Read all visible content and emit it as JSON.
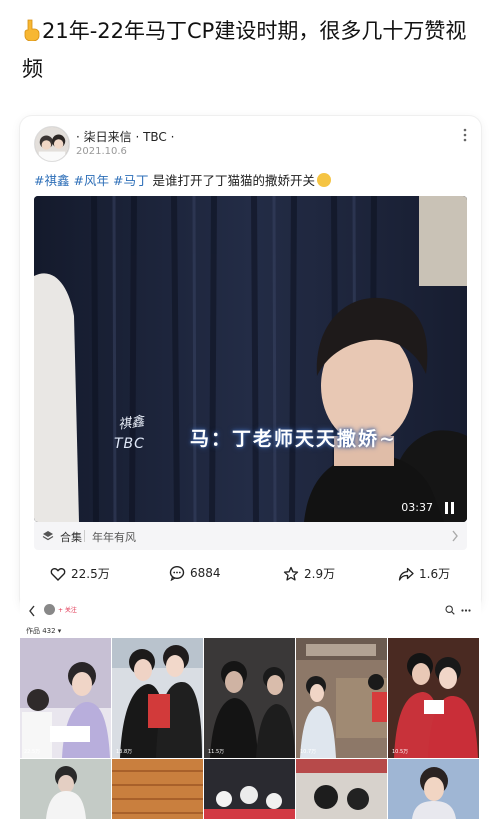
{
  "headline": "21年-22年马丁CP建设时期，很多几十万赞视频",
  "post": {
    "author": "· 柒日来信 · TBC ·",
    "date": "2021.10.6",
    "tags": [
      "#祺鑫",
      "#风年",
      "#马丁"
    ],
    "caption_text": "是谁打开了丁猫猫的撒娇开关",
    "video": {
      "subtitle": "马：丁老师天天撒娇~",
      "watermark_top": "祺鑫",
      "watermark_bottom": "TBC",
      "duration": "03:37"
    },
    "collection": {
      "label": "合集",
      "name": "年年有风"
    },
    "actions": {
      "likes": "22.5万",
      "comments": "6884",
      "favorites": "2.9万",
      "shares": "1.6万"
    }
  },
  "profile": {
    "follow_label": "+ 关注",
    "works_label": "作品 432 ▾",
    "tiles": [
      {
        "likes": "22.5万"
      },
      {
        "likes": "13.8万"
      },
      {
        "likes": "11.5万"
      },
      {
        "likes": "10.7万"
      },
      {
        "likes": "10.5万"
      }
    ]
  },
  "colors": {
    "tag_blue": "#2e6fb8",
    "curtain": "#1c2236",
    "follow_red": "#e0304e"
  }
}
